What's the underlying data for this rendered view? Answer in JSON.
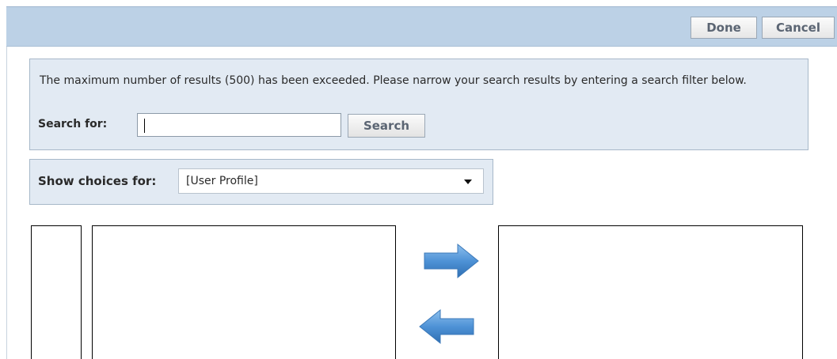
{
  "header": {
    "done_label": "Done",
    "cancel_label": "Cancel"
  },
  "notice": {
    "message": "The maximum number of results (500) has been exceeded. Please narrow your search results by entering a search filter below.",
    "search_label": "Search for:",
    "search_value": "",
    "search_button_label": "Search"
  },
  "choices": {
    "label": "Show choices for:",
    "selected_value": "[User Profile]"
  },
  "icons": {
    "move_right": "arrow-right-icon",
    "move_left": "arrow-left-icon"
  },
  "colors": {
    "header_bg": "#bcd1e6",
    "panel_bg": "#e2eaf3",
    "arrow_blue": "#5b9bd5"
  }
}
